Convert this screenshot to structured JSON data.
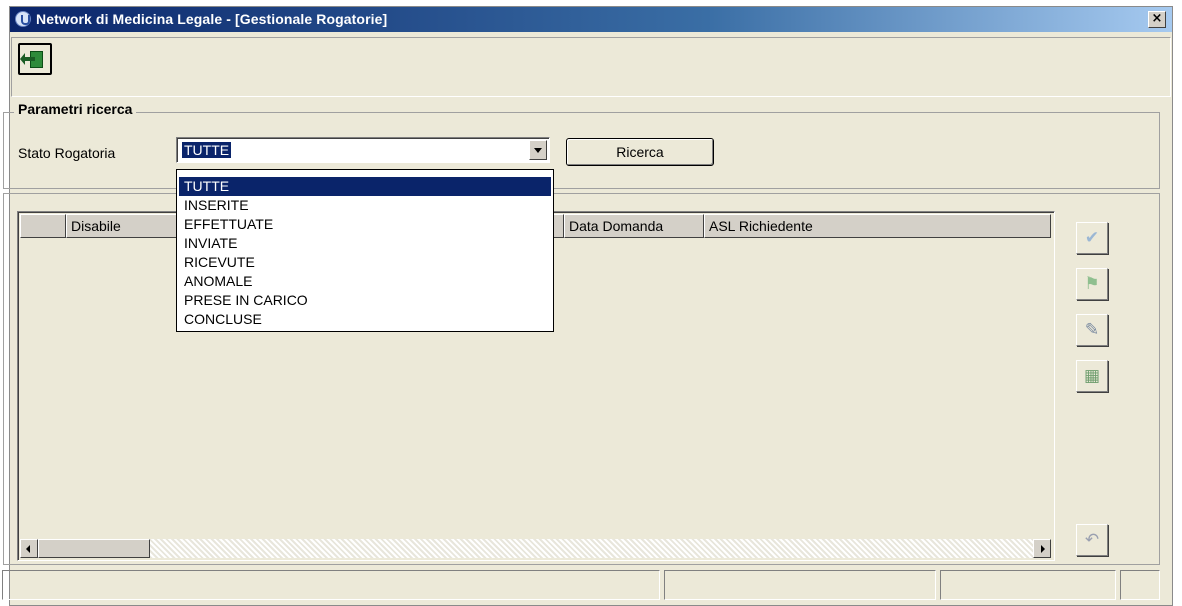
{
  "window": {
    "title": "Network di Medicina Legale - [Gestionale Rogatorie]",
    "close_glyph": "×"
  },
  "toolbar": {
    "exit_icon": "exit-door-icon"
  },
  "search": {
    "group_label": "Parametri ricerca",
    "stato_label": "Stato Rogatoria",
    "stato_value": "TUTTE",
    "button_label": "Ricerca",
    "options": [
      {
        "label": "TUTTE",
        "selected": true
      },
      {
        "label": "INSERITE",
        "selected": false
      },
      {
        "label": "EFFETTUATE",
        "selected": false
      },
      {
        "label": "INVIATE",
        "selected": false
      },
      {
        "label": "RICEVUTE",
        "selected": false
      },
      {
        "label": "ANOMALE",
        "selected": false
      },
      {
        "label": "PRESE IN CARICO",
        "selected": false
      },
      {
        "label": "CONCLUSE",
        "selected": false
      }
    ]
  },
  "grid": {
    "columns": [
      "",
      "Disabile",
      "Data Domanda",
      "ASL Richiedente"
    ],
    "rows": []
  },
  "side_actions": {
    "check_icon": "check-icon",
    "flag_icon": "flag-icon",
    "edit_icon": "edit-icon",
    "table_icon": "table-icon",
    "undo_icon": "undo-icon"
  },
  "colors": {
    "title_start": "#0a246a",
    "title_end": "#a6caf0",
    "selection": "#0a246a",
    "window_bg": "#ece9d8"
  }
}
